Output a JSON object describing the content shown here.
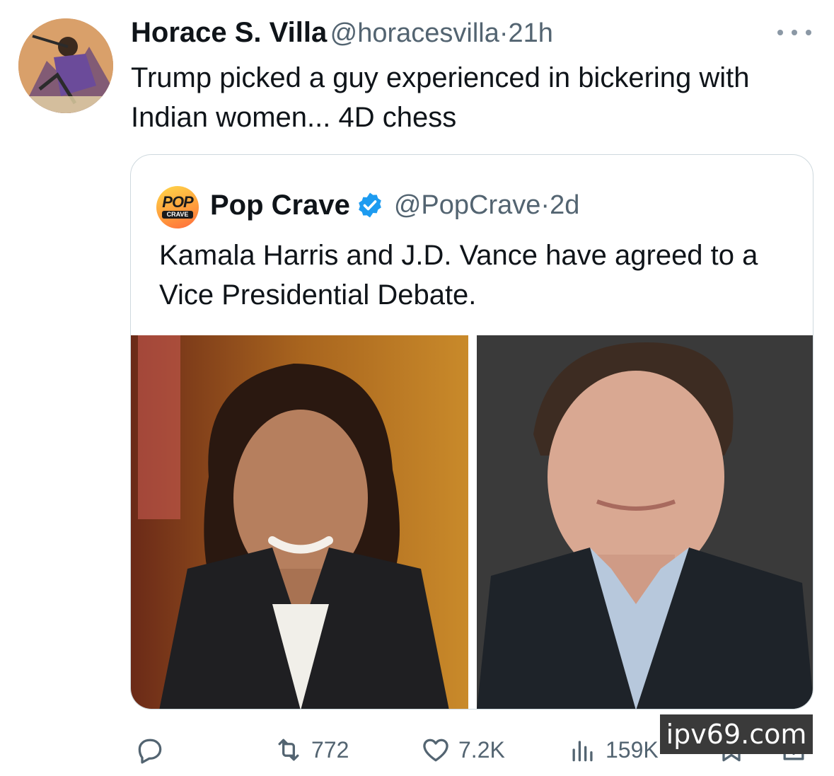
{
  "tweet": {
    "author_name": "Horace S. Villa",
    "author_handle": "@horacesvilla",
    "separator": "·",
    "time": "21h",
    "text": "Trump picked a guy experienced in bickering with Indian women... 4D chess",
    "avatar_icon": "avatar-comic-art"
  },
  "quoted_tweet": {
    "author_name": "Pop Crave",
    "verified": true,
    "author_handle": "@PopCrave",
    "separator": "·",
    "time": "2d",
    "text": "Kamala Harris and J.D. Vance have agreed to a Vice Presidential Debate.",
    "avatar_logo": {
      "top": "POP",
      "bottom": "CRAVE"
    },
    "media": [
      {
        "icon": "photo-portrait-woman"
      },
      {
        "icon": "photo-portrait-man"
      }
    ]
  },
  "actions": {
    "reply": {
      "icon": "reply-icon",
      "count": ""
    },
    "retweet": {
      "icon": "retweet-icon",
      "count": "772"
    },
    "like": {
      "icon": "heart-icon",
      "count": "7.2K"
    },
    "views": {
      "icon": "views-chart-icon",
      "count": "159K"
    },
    "bookmark": {
      "icon": "bookmark-icon"
    },
    "share": {
      "icon": "share-icon"
    }
  },
  "watermark": "ipv69.com",
  "colors": {
    "text_primary": "#0f1419",
    "text_secondary": "#536471",
    "verified_blue": "#1d9bf0",
    "border": "#cfd9de"
  }
}
